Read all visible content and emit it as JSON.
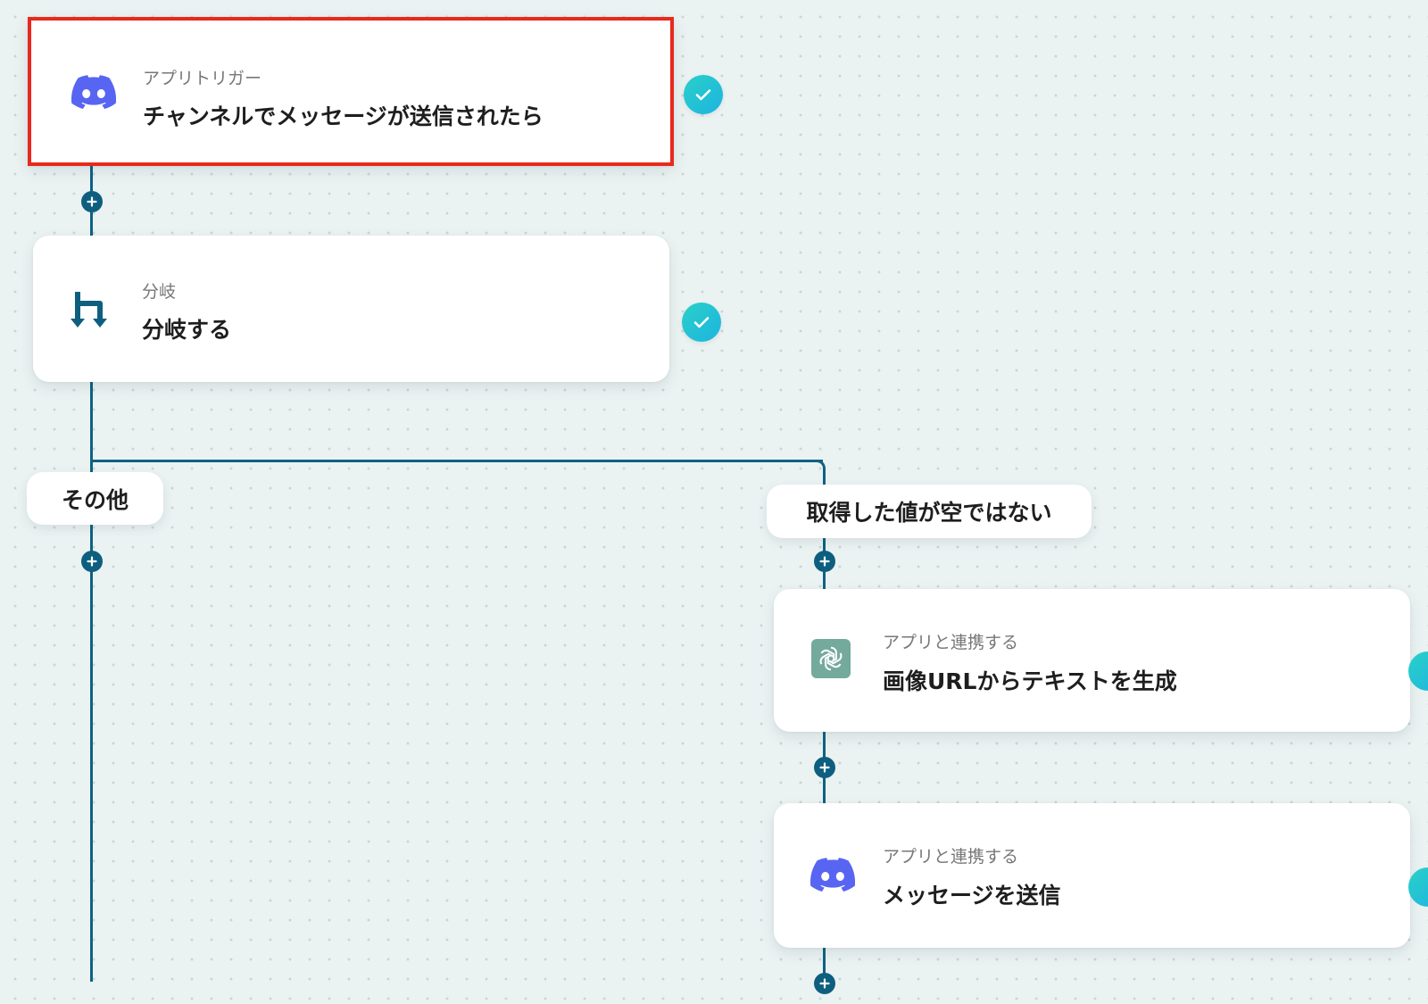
{
  "colors": {
    "connector": "#0e6283",
    "selected_border": "#e8291c",
    "check_badge": "#22c2d4",
    "discord": "#5865f2",
    "chatgpt": "#74aa9c",
    "branch_icon": "#0e5f7f"
  },
  "steps": {
    "trigger": {
      "icon": "discord-icon",
      "label": "アプリトリガー",
      "title": "チャンネルでメッセージが送信されたら",
      "status": "completed"
    },
    "branch": {
      "icon": "branch-icon",
      "label": "分岐",
      "title": "分岐する",
      "status": "completed"
    },
    "generate_text": {
      "icon": "chatgpt-icon",
      "label": "アプリと連携する",
      "title": "画像URLからテキストを生成"
    },
    "send_message": {
      "icon": "discord-icon",
      "label": "アプリと連携する",
      "title": "メッセージを送信"
    }
  },
  "branches": {
    "other": {
      "label": "その他"
    },
    "not_empty": {
      "label": "取得した値が空ではない"
    }
  }
}
